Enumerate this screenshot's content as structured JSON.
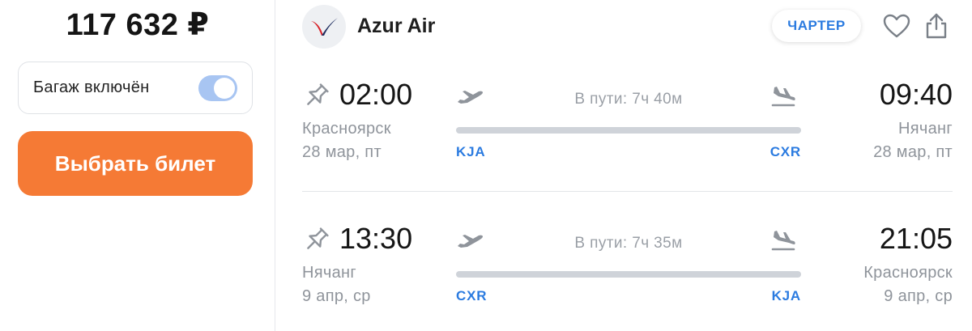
{
  "offer": {
    "price": "117 632 ₽",
    "baggage_label": "Багаж включён",
    "baggage_included": true,
    "select_button_label": "Выбрать билет"
  },
  "header": {
    "airline_name": "Azur Air",
    "badge": "ЧАРТЕР",
    "icons": [
      "airline-logo-icon",
      "heart-icon",
      "share-icon"
    ]
  },
  "segments": [
    {
      "departure_time": "02:00",
      "departure_city": "Красноярск",
      "departure_date": "28 мар, пт",
      "departure_code": "KJA",
      "duration": "В пути: 7ч 40м",
      "arrival_time": "09:40",
      "arrival_city": "Нячанг",
      "arrival_date": "28 мар, пт",
      "arrival_code": "CXR"
    },
    {
      "departure_time": "13:30",
      "departure_city": "Нячанг",
      "departure_date": "9 апр, ср",
      "departure_code": "CXR",
      "duration": "В пути: 7ч 35м",
      "arrival_time": "21:05",
      "arrival_city": "Красноярск",
      "arrival_date": "9 апр, ср",
      "arrival_code": "KJA"
    }
  ],
  "colors": {
    "accent_orange": "#f57a35",
    "link_blue": "#2b7be0",
    "toggle_on": "#a8c5f2",
    "muted_text": "#8f949b",
    "logo_red": "#d8232a",
    "logo_navy": "#1d2c5e"
  }
}
